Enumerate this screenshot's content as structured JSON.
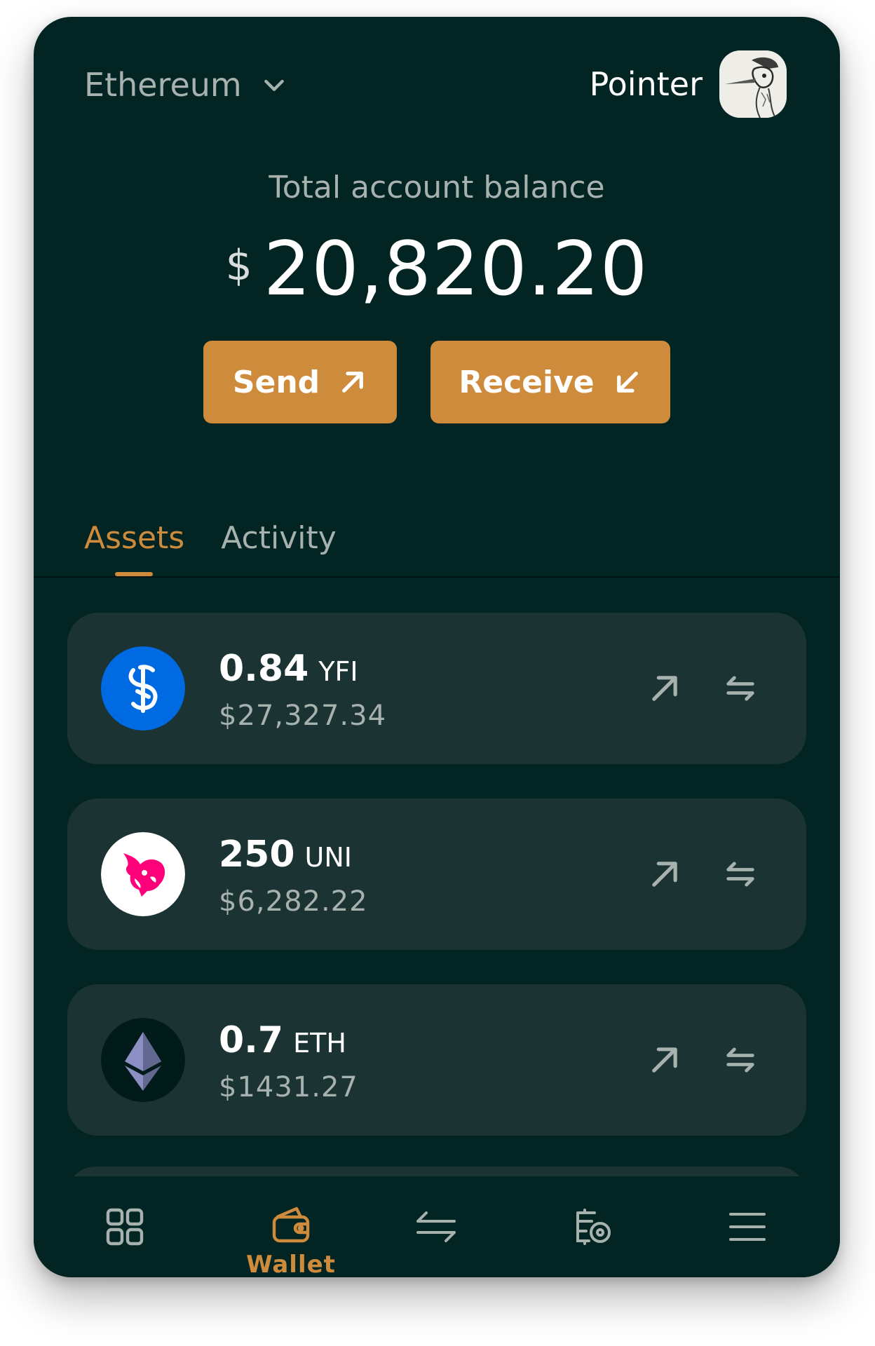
{
  "header": {
    "network": "Ethereum",
    "network_icon": "chevron-down-icon",
    "account_name": "Pointer",
    "avatar_icon": "bird-avatar"
  },
  "balance": {
    "label": "Total account balance",
    "currency": "$",
    "amount": "20,820.20"
  },
  "actions": {
    "send_label": "Send",
    "receive_label": "Receive"
  },
  "tabs": [
    {
      "label": "Assets",
      "active": true
    },
    {
      "label": "Activity",
      "active": false
    }
  ],
  "assets": [
    {
      "qty": "0.84",
      "symbol": "YFI",
      "usd": "$27,327.34",
      "icon": "yfi-token-icon",
      "color": "#006ae3"
    },
    {
      "qty": "250",
      "symbol": "UNI",
      "usd": "$6,282.22",
      "icon": "uni-token-icon",
      "color": "#ff007a"
    },
    {
      "qty": "0.7",
      "symbol": "ETH",
      "usd": "$1431.27",
      "icon": "eth-token-icon",
      "color": "#8c8fc4"
    }
  ],
  "bottom_nav": {
    "items": [
      "grid-icon",
      "wallet-icon",
      "swap-icon",
      "nft-icon",
      "menu-icon"
    ],
    "wallet_label": "Wallet",
    "active": "wallet-icon"
  },
  "colors": {
    "background": "#022524",
    "card": "#1b3433",
    "accent": "#cd8b3b",
    "muted_text": "#a7b1ae"
  }
}
